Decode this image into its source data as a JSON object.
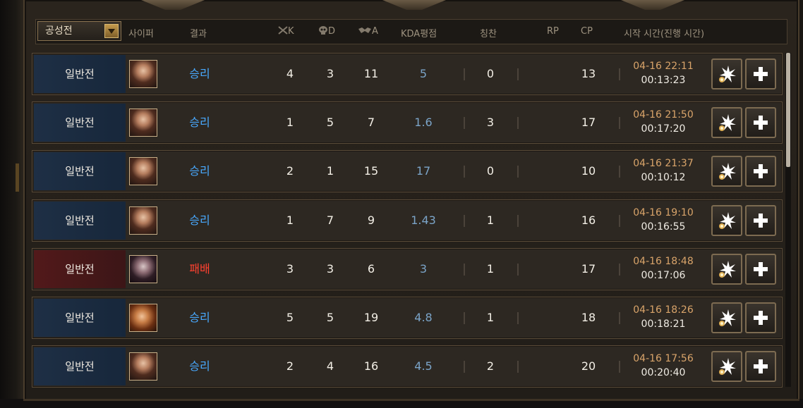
{
  "filter": {
    "selected": "공성전"
  },
  "columns": {
    "hero": "사이퍼",
    "result": "결과",
    "kills": "K",
    "deaths": "D",
    "assists": "A",
    "kda": "KDA평점",
    "praise": "칭찬",
    "rp": "RP",
    "cp": "CP",
    "time": "시작 시간(진행 시간)"
  },
  "icons": {
    "kills": "crossed-swords-icon",
    "deaths": "skull-icon",
    "assists": "handshake-icon",
    "details": "sparkle-icon",
    "add": "plus-icon"
  },
  "colors": {
    "win": "#48a9ff",
    "loss": "#ff4130",
    "kda": "#7ba4c8",
    "time": "#d9a46a"
  },
  "matches": [
    {
      "mode": "일반전",
      "outcome": "win",
      "result": "승리",
      "k": "4",
      "d": "3",
      "a": "11",
      "kda": "5",
      "praise": "0",
      "rp": "",
      "cp": "13",
      "start": "04-16 22:11",
      "duration": "00:13:23",
      "portrait": "female-fighter-portrait"
    },
    {
      "mode": "일반전",
      "outcome": "win",
      "result": "승리",
      "k": "1",
      "d": "5",
      "a": "7",
      "kda": "1.6",
      "praise": "3",
      "rp": "",
      "cp": "17",
      "start": "04-16 21:50",
      "duration": "00:17:20",
      "portrait": "female-fighter-portrait"
    },
    {
      "mode": "일반전",
      "outcome": "win",
      "result": "승리",
      "k": "2",
      "d": "1",
      "a": "15",
      "kda": "17",
      "praise": "0",
      "rp": "",
      "cp": "10",
      "start": "04-16 21:37",
      "duration": "00:10:12",
      "portrait": "female-fighter-portrait"
    },
    {
      "mode": "일반전",
      "outcome": "win",
      "result": "승리",
      "k": "1",
      "d": "7",
      "a": "9",
      "kda": "1.43",
      "praise": "1",
      "rp": "",
      "cp": "16",
      "start": "04-16 19:10",
      "duration": "00:16:55",
      "portrait": "female-fighter-portrait"
    },
    {
      "mode": "일반전",
      "outcome": "loss",
      "result": "패배",
      "k": "3",
      "d": "3",
      "a": "6",
      "kda": "3",
      "praise": "1",
      "rp": "",
      "cp": "17",
      "start": "04-16 18:48",
      "duration": "00:17:06",
      "portrait": "dark-haired-fighter-portrait"
    },
    {
      "mode": "일반전",
      "outcome": "win",
      "result": "승리",
      "k": "5",
      "d": "5",
      "a": "19",
      "kda": "4.8",
      "praise": "1",
      "rp": "",
      "cp": "18",
      "start": "04-16 18:26",
      "duration": "00:18:21",
      "portrait": "red-haired-fighter-portrait"
    },
    {
      "mode": "일반전",
      "outcome": "win",
      "result": "승리",
      "k": "2",
      "d": "4",
      "a": "16",
      "kda": "4.5",
      "praise": "2",
      "rp": "",
      "cp": "20",
      "start": "04-16 17:56",
      "duration": "00:20:40",
      "portrait": "female-fighter-portrait"
    }
  ]
}
